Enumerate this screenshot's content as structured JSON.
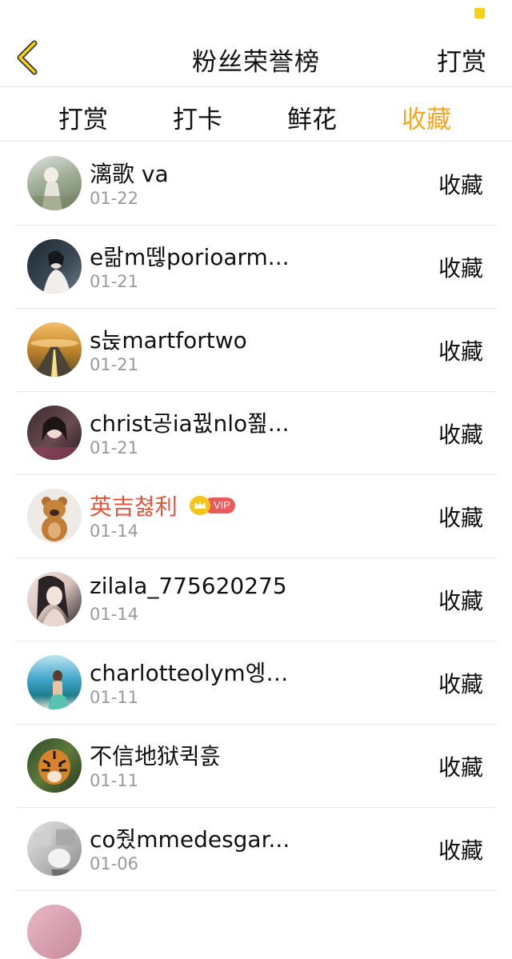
{
  "header": {
    "title": "粉丝荣誉榜",
    "action": "打赏"
  },
  "tabs": [
    {
      "label": "打赏",
      "active": false
    },
    {
      "label": "打卡",
      "active": false
    },
    {
      "label": "鲜花",
      "active": false
    },
    {
      "label": "收藏",
      "active": true
    }
  ],
  "colors": {
    "accent": "#f5a623",
    "vip_name": "#e4553c",
    "status_dot": "#f5d313"
  },
  "entries": [
    {
      "name": "漓歌 va",
      "date": "01-22",
      "action": "收藏"
    },
    {
      "name": "e랆m뗂porioarm...",
      "date": "01-21",
      "action": "收藏"
    },
    {
      "name": "s눉martfortwo",
      "date": "01-21",
      "action": "收藏"
    },
    {
      "name": "christ공ia꿦nlo쬞...",
      "date": "01-21",
      "action": "收藏"
    },
    {
      "name": "英吉쳟利",
      "date": "01-14",
      "action": "收藏",
      "vip": "VIP"
    },
    {
      "name": "zilala_775620275",
      "date": "01-14",
      "action": "收藏"
    },
    {
      "name": "charlotteolym엥…",
      "date": "01-11",
      "action": "收藏"
    },
    {
      "name": "不信地狱퀵흜",
      "date": "01-11",
      "action": "收藏"
    },
    {
      "name": "co줬mmedesgar...",
      "date": "01-06",
      "action": "收藏"
    }
  ]
}
